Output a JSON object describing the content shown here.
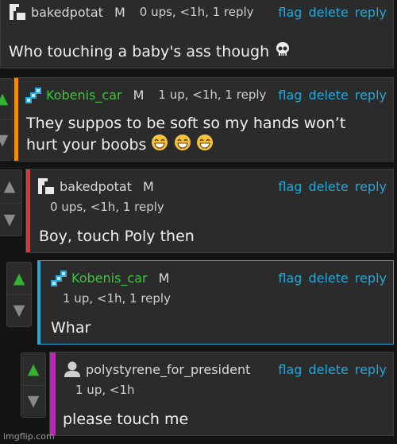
{
  "actions": {
    "flag": "flag",
    "delete": "delete",
    "reply": "reply"
  },
  "colors": {
    "accent_link": "#22a8d8",
    "upvote_active": "#2fb52f",
    "bar_orange": "#f28a10",
    "bar_red": "#e23636",
    "bar_blue": "#2aa8d8",
    "bar_magenta": "#c31fc3"
  },
  "comments": [
    {
      "username": "bakedpotat",
      "mod": "M",
      "meta": "0 ups, <1h, 1 reply",
      "body": "Who touching a baby's ass though",
      "avatar": "bakedpotat-icon"
    },
    {
      "username": "Kobenis_car",
      "mod": "M",
      "meta": "1 up, <1h, 1 reply",
      "body_line1": "They suppos to be soft so my hands won’t",
      "body_line2": "hurt your boobs",
      "avatar": "kobenis-icon"
    },
    {
      "username": "bakedpotat",
      "mod": "M",
      "meta": "0 ups, <1h, 1 reply",
      "body": "Boy, touch Poly then",
      "avatar": "bakedpotat-icon"
    },
    {
      "username": "Kobenis_car",
      "mod": "M",
      "meta": "1 up, <1h, 1 reply",
      "body": "Whar",
      "avatar": "kobenis-icon"
    },
    {
      "username": "polystyrene_for_president",
      "meta": "1 up, <1h",
      "body": "please touch me",
      "avatar": "default-user-icon"
    }
  ],
  "vote_icons": {
    "up": "▲",
    "down": "▼"
  },
  "watermark": "imgflip.com"
}
